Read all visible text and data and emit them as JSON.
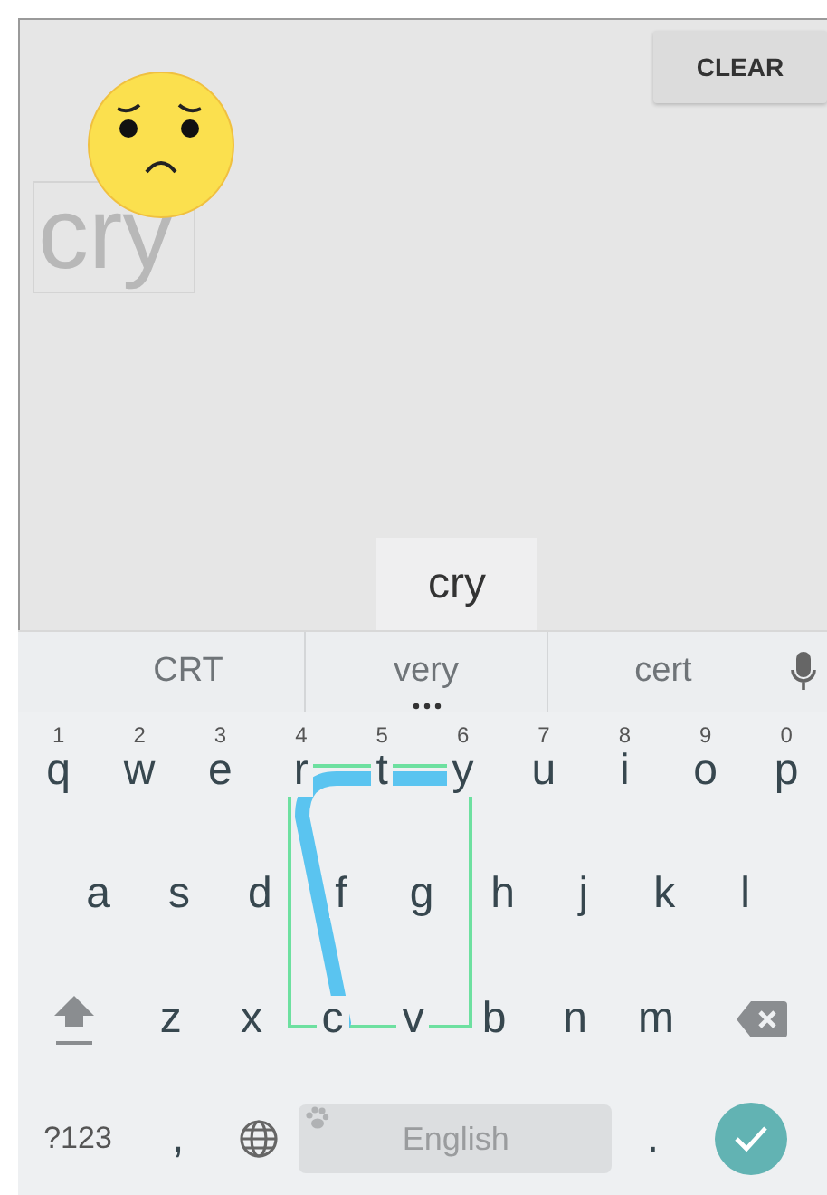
{
  "clear_button": {
    "label": "CLEAR"
  },
  "recognized_text": "cry",
  "preview": "cry",
  "suggestions": [
    {
      "text": "CRT",
      "more": false
    },
    {
      "text": "very",
      "more": true
    },
    {
      "text": "cert",
      "more": false
    }
  ],
  "keyboard": {
    "rows": [
      [
        {
          "kind": "letter",
          "label": "q",
          "hint": "1"
        },
        {
          "kind": "letter",
          "label": "w",
          "hint": "2"
        },
        {
          "kind": "letter",
          "label": "e",
          "hint": "3"
        },
        {
          "kind": "letter",
          "label": "r",
          "hint": "4"
        },
        {
          "kind": "letter",
          "label": "t",
          "hint": "5"
        },
        {
          "kind": "letter",
          "label": "y",
          "hint": "6"
        },
        {
          "kind": "letter",
          "label": "u",
          "hint": "7"
        },
        {
          "kind": "letter",
          "label": "i",
          "hint": "8"
        },
        {
          "kind": "letter",
          "label": "o",
          "hint": "9"
        },
        {
          "kind": "letter",
          "label": "p",
          "hint": "0"
        }
      ],
      [
        {
          "kind": "letter",
          "label": "a"
        },
        {
          "kind": "letter",
          "label": "s"
        },
        {
          "kind": "letter",
          "label": "d"
        },
        {
          "kind": "letter",
          "label": "f"
        },
        {
          "kind": "letter",
          "label": "g"
        },
        {
          "kind": "letter",
          "label": "h"
        },
        {
          "kind": "letter",
          "label": "j"
        },
        {
          "kind": "letter",
          "label": "k"
        },
        {
          "kind": "letter",
          "label": "l"
        }
      ],
      [
        {
          "kind": "shift"
        },
        {
          "kind": "letter",
          "label": "z"
        },
        {
          "kind": "letter",
          "label": "x"
        },
        {
          "kind": "letter",
          "label": "c"
        },
        {
          "kind": "letter",
          "label": "v"
        },
        {
          "kind": "letter",
          "label": "b"
        },
        {
          "kind": "letter",
          "label": "n"
        },
        {
          "kind": "letter",
          "label": "m"
        },
        {
          "kind": "backspace"
        }
      ]
    ],
    "bottom_bar": [
      {
        "kind": "symbols",
        "label": "?123"
      },
      {
        "kind": "letter",
        "label": ","
      },
      {
        "kind": "globe"
      },
      {
        "kind": "space",
        "label": "English"
      },
      {
        "kind": "letter",
        "label": "."
      },
      {
        "kind": "enter"
      }
    ]
  }
}
